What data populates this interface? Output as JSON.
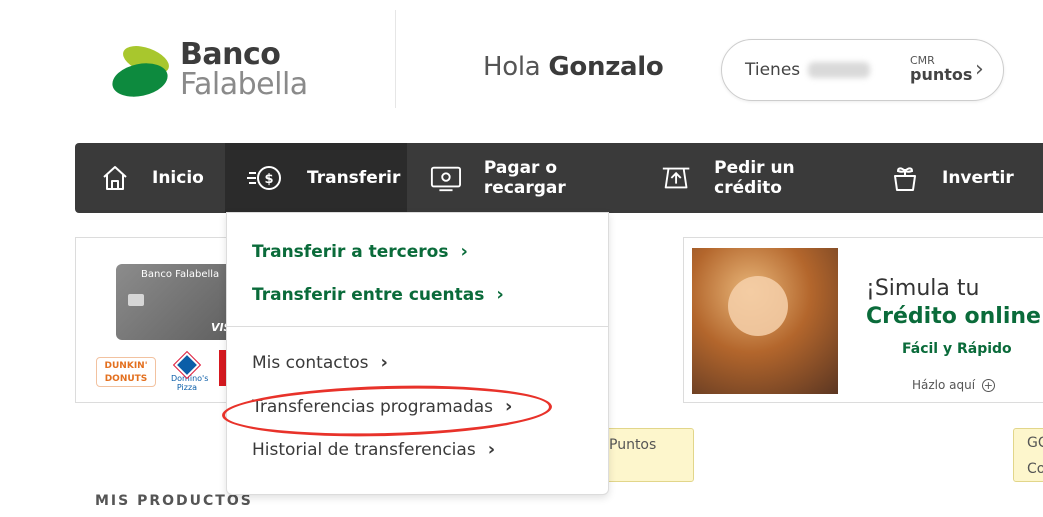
{
  "header": {
    "logo": {
      "line1": "Banco",
      "line2": "Falabella"
    },
    "greeting_prefix": "Hola",
    "user_name": "Gonzalo",
    "points": {
      "label": "Tienes",
      "value_hidden": "93.068",
      "brand_top": "CMR",
      "brand_bottom": "puntos"
    }
  },
  "nav": {
    "items": [
      {
        "label": "Inicio",
        "icon": "home-icon"
      },
      {
        "label": "Transferir",
        "icon": "transfer-money-icon"
      },
      {
        "label": "Pagar o recargar",
        "icon": "payment-screen-icon"
      },
      {
        "label": "Pedir un crédito",
        "icon": "credit-icon"
      },
      {
        "label": "Invertir",
        "icon": "investment-icon"
      }
    ]
  },
  "dropdown": {
    "items": [
      {
        "label": "Transferir a terceros"
      },
      {
        "label": "Transferir entre cuentas"
      },
      {
        "label": "Mis contactos"
      },
      {
        "label": "Transferencias programadas"
      },
      {
        "label": "Historial de transferencias"
      }
    ]
  },
  "promo": {
    "card_bank": "Banco Falabella",
    "card_network": "VISA",
    "dunkin": "DUNKIN' DONUTS",
    "dominos": "Domino's Pizza",
    "simula_line1": "¡Simula tu",
    "simula_line2": "Crédito online!",
    "simula_sub": "Fácil y Rápido",
    "simula_cta": "Házlo aquí"
  },
  "background": {
    "yellow_card_1": "Puntos",
    "yellow_card_2_l1": "GC",
    "yellow_card_2_l2": "Co",
    "section_title": "MIS PRODUCTOS"
  },
  "colors": {
    "brand_green": "#0a6b3a",
    "nav_bg": "#3a3a3a",
    "highlight": "#e8322a"
  }
}
